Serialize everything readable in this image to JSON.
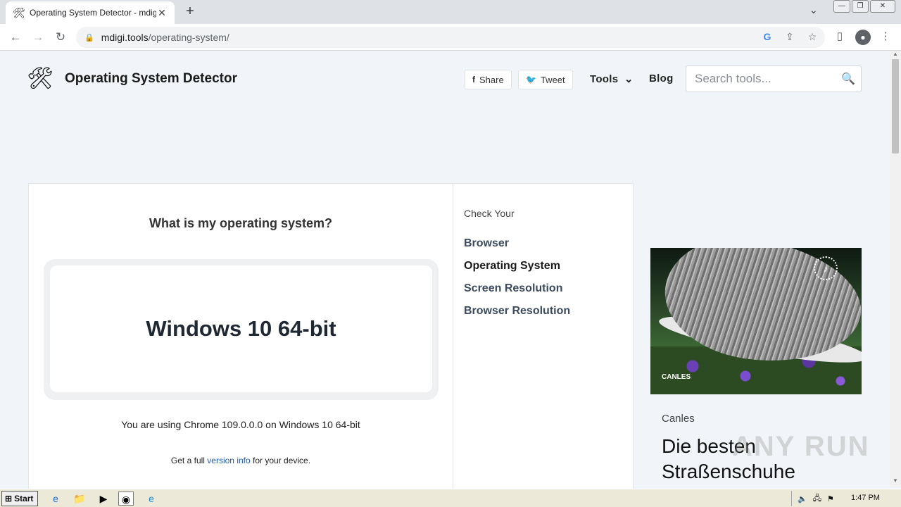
{
  "browser": {
    "tab_title": "Operating System Detector - mdigi.t",
    "url_host": "mdigi.tools",
    "url_path": "/operating-system/"
  },
  "header": {
    "site_title": "Operating System Detector",
    "share_label": "Share",
    "tweet_label": "Tweet",
    "tools_label": "Tools",
    "blog_label": "Blog",
    "search_placeholder": "Search tools..."
  },
  "main": {
    "question": "What is my operating system?",
    "os_result": "Windows 10 64-bit",
    "using_line": "You are using Chrome 109.0.0.0 on Windows 10 64-bit",
    "full_info_prefix": "Get a full",
    "full_info_link": "version info",
    "full_info_suffix": "for your device."
  },
  "sidebar": {
    "heading": "Check Your",
    "links": [
      "Browser",
      "Operating System",
      "Screen Resolution",
      "Browser Resolution"
    ]
  },
  "ad": {
    "brand_mark": "CANLES",
    "advertiser": "Canles",
    "headline": "Die besten Straßenschuhe"
  },
  "watermark": "ANY RUN",
  "taskbar": {
    "start_label": "Start",
    "clock": "1:47 PM"
  },
  "colors": {
    "page_bg": "#f1f4f8",
    "link_blue": "#1f5eb2",
    "text_dark": "#1f2933"
  }
}
